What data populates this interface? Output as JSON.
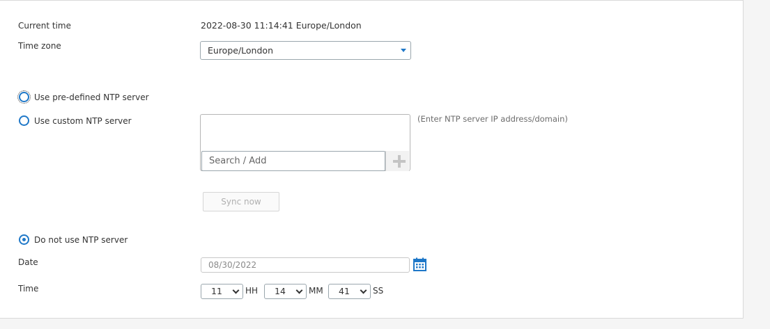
{
  "current_time": {
    "label": "Current time",
    "value": "2022-08-30 11:14:41 Europe/London"
  },
  "time_zone": {
    "label": "Time zone",
    "selected": "Europe/London"
  },
  "ntp_options": {
    "predefined": {
      "label": "Use pre-defined NTP server",
      "checked": false
    },
    "custom": {
      "label": "Use custom NTP server",
      "checked": false
    },
    "none": {
      "label": "Do not use NTP server",
      "checked": true
    }
  },
  "ntp_server": {
    "search_placeholder": "Search / Add",
    "hint": "(Enter NTP server IP address/domain)"
  },
  "sync_button": {
    "label": "Sync now"
  },
  "date": {
    "label": "Date",
    "value": "08/30/2022"
  },
  "time": {
    "label": "Time",
    "hour": "11",
    "hour_unit": "HH",
    "minute": "14",
    "minute_unit": "MM",
    "second": "41",
    "second_unit": "SS"
  },
  "colors": {
    "accent": "#1f78c8",
    "border": "#9aa6ad",
    "background": "#f5f5f5"
  }
}
